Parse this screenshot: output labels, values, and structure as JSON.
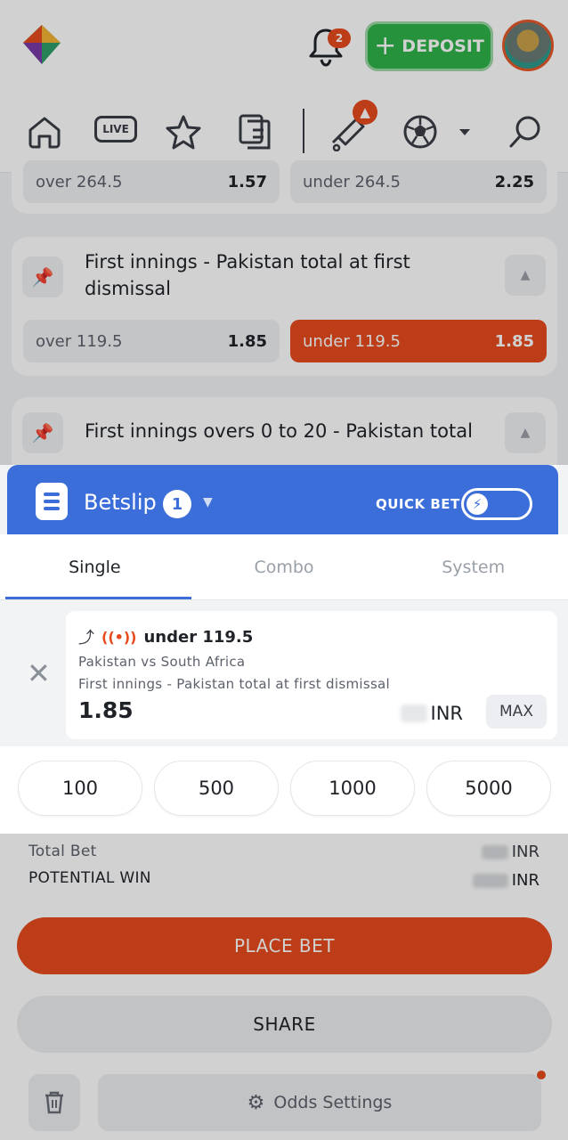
{
  "header": {
    "notification_count": "2",
    "deposit_label": "DEPOSIT"
  },
  "nav": {
    "live_label": "LIVE"
  },
  "markets": [
    {
      "outcomes": [
        {
          "label": "over 264.5",
          "odds": "1.57"
        },
        {
          "label": "under 264.5",
          "odds": "2.25"
        }
      ]
    },
    {
      "title": "First innings - Pakistan total at first dismissal",
      "outcomes": [
        {
          "label": "over 119.5",
          "odds": "1.85"
        },
        {
          "label": "under 119.5",
          "odds": "1.85",
          "selected": true
        }
      ]
    },
    {
      "title": "First innings overs 0 to 20 - Pakistan total"
    }
  ],
  "betslip": {
    "title": "Betslip",
    "count": "1",
    "quick_bet_label": "QUICK BET",
    "tabs": [
      {
        "label": "Single",
        "active": true
      },
      {
        "label": "Combo"
      },
      {
        "label": "System"
      }
    ],
    "bet": {
      "selection": "under 119.5",
      "match": "Pakistan vs South Africa",
      "market": "First innings - Pakistan total at first dismissal",
      "odds": "1.85",
      "currency": "INR",
      "max_label": "MAX"
    },
    "quick_amounts": [
      "100",
      "500",
      "1000",
      "5000"
    ],
    "total_bet_label": "Total Bet",
    "total_bet_currency": "INR",
    "potential_win_label": "POTENTIAL WIN",
    "potential_win_currency": "INR",
    "place_bet_label": "PLACE BET",
    "share_label": "SHARE",
    "odds_settings_label": "Odds Settings"
  },
  "colors": {
    "accent_orange": "#e64b1e",
    "betslip_blue": "#3c6ed9",
    "deposit_green": "#2fb34a"
  }
}
